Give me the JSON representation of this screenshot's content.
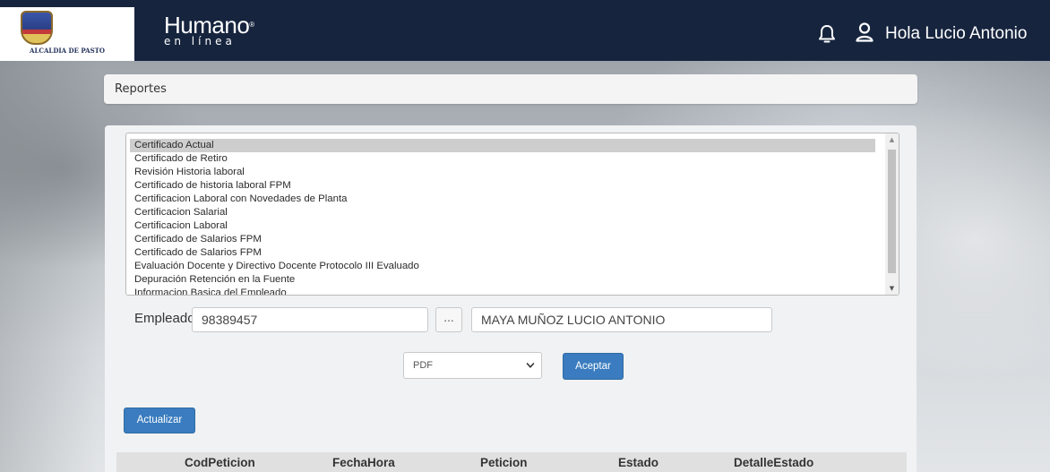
{
  "header": {
    "logo_caption": "ALCALDIA DE PASTO",
    "brand_main": "Humano",
    "brand_mark": "®",
    "brand_sub": "en línea",
    "greeting": "Hola Lucio Antonio",
    "icons": [
      "bell-icon",
      "user-icon"
    ]
  },
  "breadcrumb": {
    "title": "Reportes"
  },
  "report_list": {
    "selected_index": 0,
    "items": [
      "Certificado Actual",
      "Certificado de Retiro",
      "Revisión Historia laboral",
      "Certificado de historia laboral FPM",
      "Certificacion Laboral con Novedades de Planta",
      "Certificacion Salarial",
      "Certificacion Laboral",
      "Certificado de Salarios FPM",
      "Certificado de Salarios FPM",
      "Evaluación Docente y Directivo Docente Protocolo III Evaluado",
      "Depuración Retención en la Fuente",
      "Informacion Basica del Empleado"
    ]
  },
  "employee": {
    "label": "Empleado",
    "code": "98389457",
    "lookup_label": "...",
    "name": "MAYA MUÑOZ LUCIO ANTONIO"
  },
  "format": {
    "selected": "PDF"
  },
  "buttons": {
    "accept": "Aceptar",
    "refresh": "Actualizar"
  },
  "table": {
    "columns": [
      "CodPeticion",
      "FechaHora",
      "Peticion",
      "Estado",
      "DetalleEstado"
    ]
  },
  "colors": {
    "topbar": "#16243e",
    "primary_button": "#3a7cbf",
    "panel": "#f1f2f3"
  }
}
